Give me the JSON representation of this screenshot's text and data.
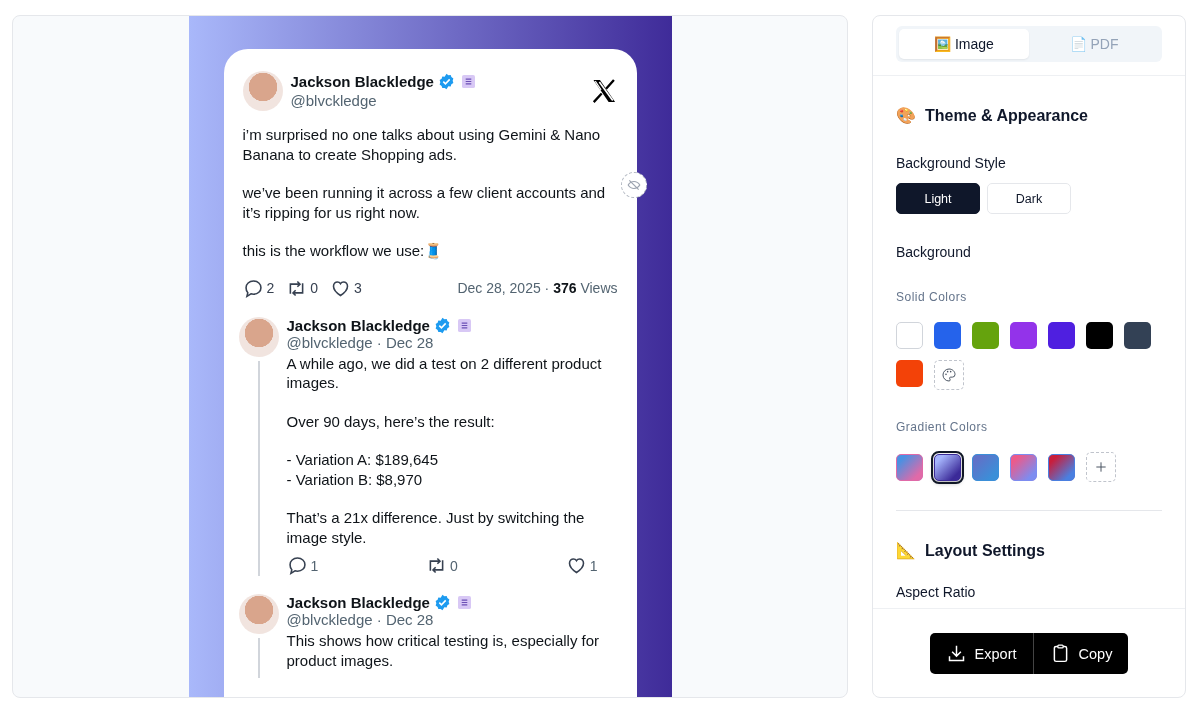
{
  "tweet": {
    "author": "Jackson Blackledge",
    "handle": "@blvckledge",
    "paragraphs": [
      "i’m surprised no one talks about using Gemini & Nano Banana to create Shopping ads.",
      "we’ve been running it across a few client accounts and it’s ripping for us right now.",
      "this is the workflow we use:🧵"
    ],
    "stats": {
      "replies": "2",
      "reposts": "0",
      "likes": "3"
    },
    "meta": "Dec 28, 2025 · **376** Views"
  },
  "replies": [
    {
      "author": "Jackson Blackledge",
      "handle": "@blvckledge · Dec 28",
      "paragraphs": [
        "A while ago, we did a test on 2 different product images.",
        "Over 90 days, here’s the result:",
        "- Variation A: $189,645\n- Variation B: $8,970",
        "That’s a 21x difference. Just by switching the image style."
      ],
      "stats": {
        "replies": "1",
        "reposts": "0",
        "likes": "1"
      }
    },
    {
      "author": "Jackson Blackledge",
      "handle": "@blvckledge · Dec 28",
      "paragraphs": [
        "This shows how critical testing is, especially for product images."
      ]
    }
  ],
  "sidebar": {
    "tabs": [
      {
        "icon": "🖼️",
        "label": "Image",
        "selected": true
      },
      {
        "icon": "📄",
        "label": "PDF",
        "selected": false
      }
    ],
    "theme_section": {
      "icon": "🎨",
      "title": "Theme & Appearance",
      "style_label": "Background Style",
      "styles": [
        {
          "label": "Light",
          "selected": true
        },
        {
          "label": "Dark",
          "selected": false
        }
      ],
      "background_label": "Background",
      "solid_label": "Solid Colors",
      "solid_colors": [
        {
          "color": "#ffffff",
          "selected": false
        },
        {
          "color": "#2563eb",
          "selected": false
        },
        {
          "color": "#65a30d",
          "selected": false
        },
        {
          "color": "#9333ea",
          "selected": false
        },
        {
          "color": "#4f1fe0",
          "selected": false
        },
        {
          "color": "#000000",
          "selected": false
        },
        {
          "color": "#334155",
          "selected": false
        },
        {
          "color": "#f34208",
          "selected": false
        }
      ],
      "gradient_label": "Gradient Colors",
      "gradients": [
        {
          "stops": [
            {
              "color": "#4a90e2"
            },
            {
              "color": "#e06aa8"
            }
          ],
          "selected": false
        },
        {
          "stops": [
            {
              "color": "#a5b4fc"
            },
            {
              "color": "#3b2a98"
            }
          ],
          "selected": true
        },
        {
          "stops": [
            {
              "color": "#5f72c8"
            },
            {
              "color": "#3b8fd8"
            }
          ],
          "selected": false
        },
        {
          "stops": [
            {
              "color": "#ec5a8a"
            },
            {
              "color": "#7d8cf0"
            }
          ],
          "selected": false
        },
        {
          "stops": [
            {
              "color": "#c81e3c"
            },
            {
              "color": "#4a7fe0"
            }
          ],
          "selected": false
        }
      ]
    },
    "layout_section": {
      "icon": "📐",
      "title": "Layout Settings",
      "first_label": "Aspect Ratio"
    },
    "actions": [
      {
        "kind": "export",
        "label": "Export"
      },
      {
        "kind": "copy",
        "label": "Copy"
      }
    ]
  }
}
